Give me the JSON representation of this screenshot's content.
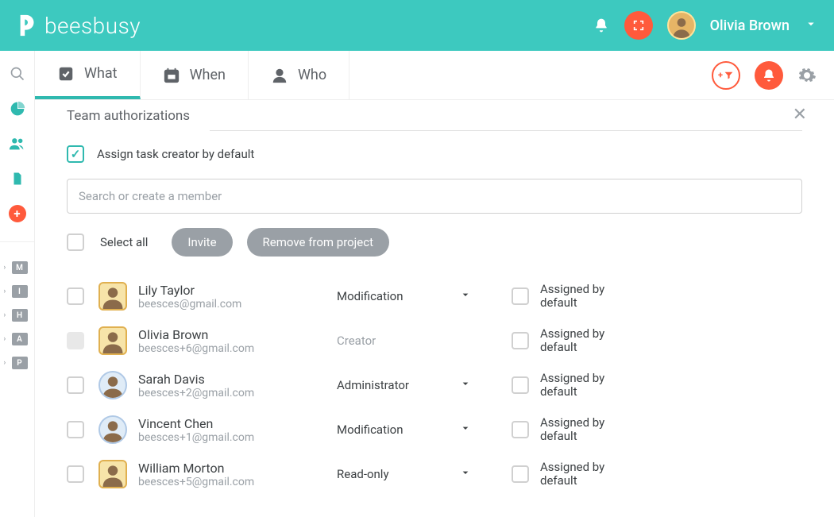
{
  "header": {
    "logo_text": "beesbusy",
    "user_name": "Olivia Brown"
  },
  "tabs": {
    "what": "What",
    "when": "When",
    "who": "Who"
  },
  "sidebar_minis": [
    "M",
    "I",
    "H",
    "A",
    "P"
  ],
  "panel": {
    "title": "Team authorizations",
    "assign_default_label": "Assign task creator by default",
    "search_placeholder": "Search or create a member",
    "select_all_label": "Select all",
    "invite_label": "Invite",
    "remove_label": "Remove from project",
    "assigned_label": "Assigned by default"
  },
  "members": [
    {
      "name": "Lily Taylor",
      "email": "beesces@gmail.com",
      "role": "Modification",
      "role_dropdown": true,
      "avatar_style": "hex",
      "checkbox_disabled": false
    },
    {
      "name": "Olivia Brown",
      "email": "beesces+6@gmail.com",
      "role": "Creator",
      "role_dropdown": false,
      "avatar_style": "hex",
      "checkbox_disabled": true
    },
    {
      "name": "Sarah Davis",
      "email": "beesces+2@gmail.com",
      "role": "Administrator",
      "role_dropdown": true,
      "avatar_style": "circle",
      "checkbox_disabled": false
    },
    {
      "name": "Vincent Chen",
      "email": "beesces+1@gmail.com",
      "role": "Modification",
      "role_dropdown": true,
      "avatar_style": "circle",
      "checkbox_disabled": false
    },
    {
      "name": "William Morton",
      "email": "beesces+5@gmail.com",
      "role": "Read-only",
      "role_dropdown": true,
      "avatar_style": "hex",
      "checkbox_disabled": false
    }
  ]
}
